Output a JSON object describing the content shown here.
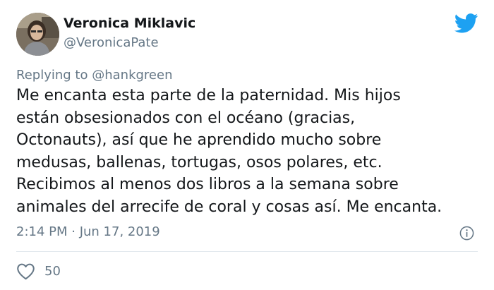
{
  "author": {
    "name": "Veronica Miklavic",
    "handle": "@VeronicaPate"
  },
  "reply": {
    "prefix": "Replying to",
    "mention": "@hankgreen"
  },
  "body_lines": [
    "Me encanta esta parte de la paternidad. Mis hijos",
    "están obsesionados con el océano (gracias,",
    "Octonauts), así que he aprendido mucho sobre",
    "medusas, ballenas, tortugas, osos polares, etc.",
    "Recibimos al menos dos libros a la semana sobre",
    "animales del arrecife de coral y cosas así. Me encanta."
  ],
  "timestamp": "2:14 PM · Jun 17, 2019",
  "likes": "50",
  "icons": {
    "brand": "twitter-bird-icon",
    "info": "info-icon",
    "like": "heart-icon"
  },
  "colors": {
    "brand": "#1da1f2",
    "muted": "#657786",
    "text": "#14171a",
    "divider": "#e1e8ed"
  }
}
